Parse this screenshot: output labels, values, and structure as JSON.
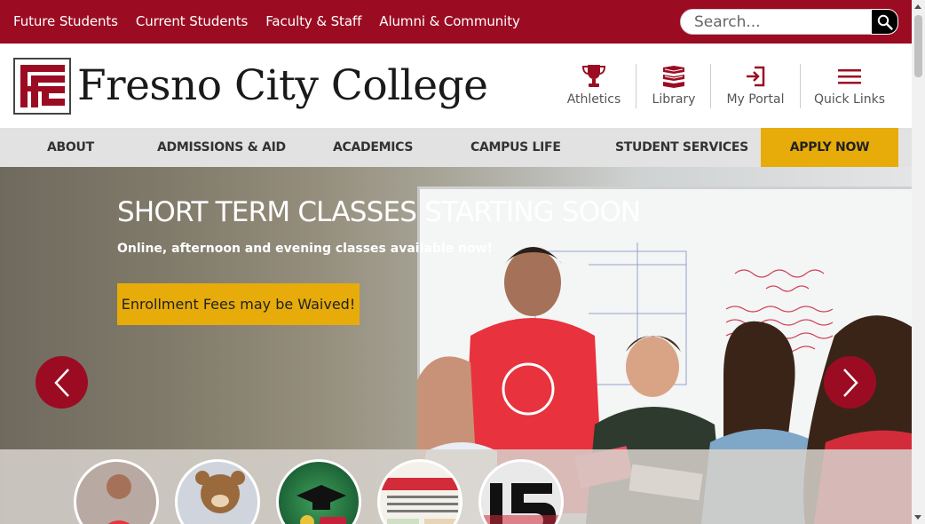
{
  "topnav": {
    "links": [
      "Future Students",
      "Current Students",
      "Faculty & Staff",
      "Alumni & Community"
    ]
  },
  "search": {
    "placeholder": "Search..."
  },
  "header": {
    "college_name": "Fresno City College",
    "quick_links": [
      {
        "label": "Athletics",
        "icon": "trophy-icon"
      },
      {
        "label": "Library",
        "icon": "books-icon"
      },
      {
        "label": "My Portal",
        "icon": "sign-in-icon"
      },
      {
        "label": "Quick Links",
        "icon": "hamburger-menu-icon"
      }
    ]
  },
  "mainnav": {
    "items": [
      "ABOUT",
      "ADMISSIONS & AID",
      "ACADEMICS",
      "CAMPUS LIFE",
      "STUDENT SERVICES"
    ],
    "apply": "APPLY NOW"
  },
  "hero": {
    "title": "SHORT TERM CLASSES STARTING SOON",
    "subtitle": "Online, afternoon and evening classes available now!",
    "cta": "Enrollment Fees may be Waived!"
  },
  "colors": {
    "brand_red": "#9b0c23",
    "accent_gold": "#e7ac09",
    "nav_gray": "#e2e2e2"
  }
}
